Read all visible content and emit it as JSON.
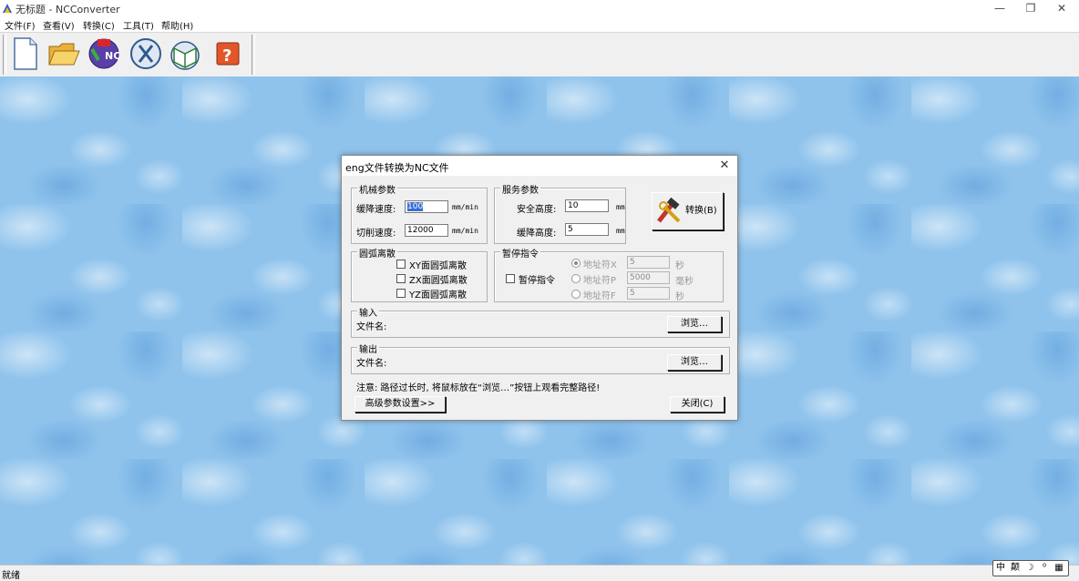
{
  "window": {
    "title": "无标题 - NCConverter",
    "minimize": "—",
    "restore": "❐",
    "close": "✕"
  },
  "menu": [
    "文件(F)",
    "查看(V)",
    "转换(C)",
    "工具(T)",
    "帮助(H)"
  ],
  "toolbar": {
    "new_icon": "document-icon",
    "open_icon": "folder-icon",
    "convert_label": "NC",
    "help_label": "?"
  },
  "dialog": {
    "title": "eng文件转换为NC文件",
    "close": "✕",
    "mech": {
      "title": "机械参数",
      "down_speed_label": "缓降速度:",
      "down_speed_value": "100",
      "down_speed_unit": "mm/min",
      "cut_speed_label": "切削速度:",
      "cut_speed_value": "12000",
      "cut_speed_unit": "mm/min"
    },
    "service": {
      "title": "服务参数",
      "safe_height_label": "安全高度:",
      "safe_height_value": "10",
      "safe_height_unit": "mm",
      "down_height_label": "缓降高度:",
      "down_height_value": "5",
      "down_height_unit": "mm"
    },
    "convert_button": "转换(B)",
    "arc": {
      "title": "圆弧离散",
      "xy": "XY面圆弧离散",
      "zx": "ZX面圆弧离散",
      "yz": "YZ面圆弧离散"
    },
    "pause": {
      "title": "暂停指令",
      "checkbox": "暂停指令",
      "opt1_label": "地址符X",
      "opt1_value": "5",
      "opt1_unit": "秒",
      "opt2_label": "地址符P",
      "opt2_value": "5000",
      "opt2_unit": "毫秒",
      "opt3_label": "地址符F",
      "opt3_value": "5",
      "opt3_unit": "秒"
    },
    "input": {
      "title": "输入",
      "filename_label": "文件名:",
      "browse": "浏览…"
    },
    "output": {
      "title": "输出",
      "filename_label": "文件名:",
      "browse": "浏览…"
    },
    "note": "注意: 路径过长时, 将鼠标放在“浏览…”按钮上观看完整路径!",
    "advanced_button": "高级参数设置>>",
    "close_button": "关闭(C)"
  },
  "status": {
    "text": "就绪"
  },
  "ime": [
    "中",
    "颠",
    "☽",
    "⁰",
    "▦"
  ]
}
